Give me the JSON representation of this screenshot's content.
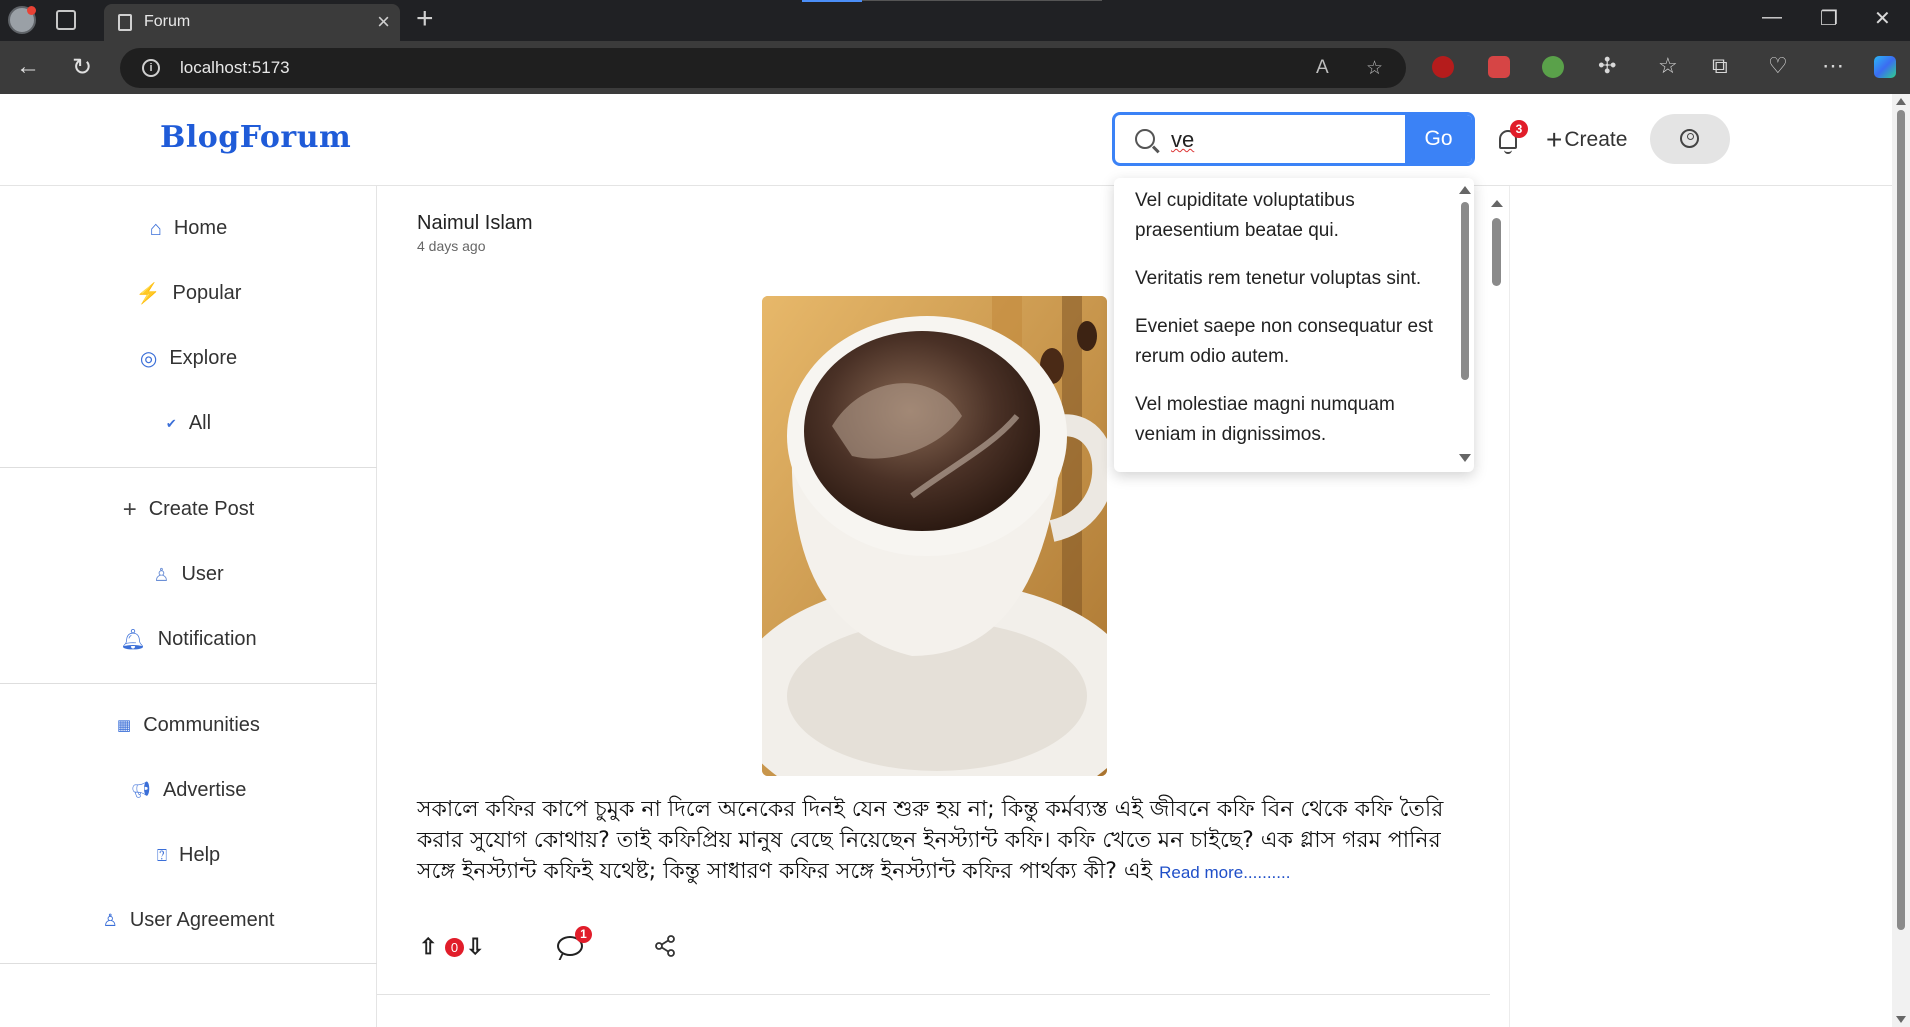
{
  "browser": {
    "tab_title": "Forum",
    "url": "localhost:5173",
    "new_tab_label": "+",
    "close_tab_label": "×"
  },
  "header": {
    "logo": "BlogForum",
    "search_value": "ve",
    "go_label": "Go",
    "notification_count": "3",
    "create_label": "Create"
  },
  "sidebar": {
    "items": [
      {
        "label": "Home",
        "icon": "home-icon"
      },
      {
        "label": "Popular",
        "icon": "bolt-icon"
      },
      {
        "label": "Explore",
        "icon": "compass-icon"
      },
      {
        "label": "All",
        "icon": "check-icon"
      },
      {
        "label": "Create Post",
        "icon": "plus-icon"
      },
      {
        "label": "User",
        "icon": "user-icon"
      },
      {
        "label": "Notification",
        "icon": "bell-icon"
      },
      {
        "label": "Communities",
        "icon": "communities-icon"
      },
      {
        "label": "Advertise",
        "icon": "megaphone-icon"
      },
      {
        "label": "Help",
        "icon": "help-icon"
      },
      {
        "label": "User Agreement",
        "icon": "user-agreement-icon"
      }
    ]
  },
  "post": {
    "author": "Naimul Islam",
    "time": "4 days ago",
    "body": "সকালে কফির কাপে চুমুক না দিলে অনেকের দিনই যেন শুরু হয় না; কিন্তু কর্মব্যস্ত এই জীবনে কফি বিন থেকে কফি তৈরি করার সুযোগ কোথায়? তাই কফিপ্রিয় মানুষ বেছে নিয়েছেন ইনস্ট্যান্ট কফি। কফি খেতে মন চাইছে? এক গ্লাস গরম পানির সঙ্গে ইনস্ট্যান্ট কফিই যথেষ্ট; কিন্তু সাধারণ কফির সঙ্গে ইনস্ট্যান্ট কফির পার্থক্য কী? এই ",
    "read_more": "Read more..........",
    "vote_count": "0",
    "comment_count": "1"
  },
  "suggestions": [
    "Vel cupiditate voluptatibus praesentium beatae qui.",
    "Veritatis rem tenetur voluptas sint.",
    "Eveniet saepe non consequatur est rerum odio autem.",
    "Vel molestiae magni numquam veniam in dignissimos."
  ],
  "colors": {
    "accent": "#3b82f6",
    "logo": "#1f5bd8",
    "badge": "#e11d2a"
  }
}
